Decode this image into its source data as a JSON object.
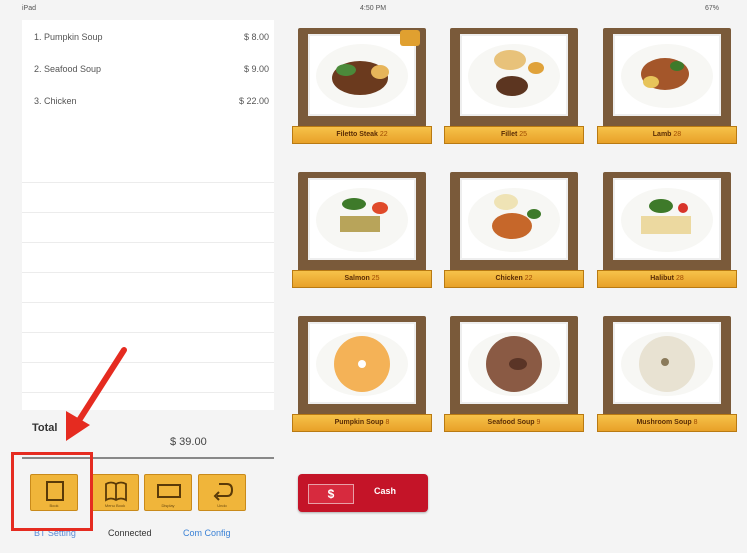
{
  "status_bar": {
    "left": "iPad",
    "center": "4:50 PM",
    "right": "67%"
  },
  "order_items": [
    {
      "name": "1. Pumpkin Soup",
      "price": "$ 8.00"
    },
    {
      "name": "2. Seafood Soup",
      "price": "$ 9.00"
    },
    {
      "name": "3. Chicken",
      "price": "$ 22.00"
    }
  ],
  "total": {
    "label": "Total",
    "value": "$ 39.00"
  },
  "toolbar": {
    "buttons": [
      {
        "label": "Book"
      },
      {
        "label": "Menu Book"
      },
      {
        "label": "Display"
      },
      {
        "label": "Undo"
      }
    ]
  },
  "footer": {
    "left": "BT Setting",
    "status": "Connected",
    "config": "Com Config"
  },
  "menu": [
    {
      "name": "Filetto Steak",
      "price": "22"
    },
    {
      "name": "Fillet",
      "price": "25"
    },
    {
      "name": "Lamb",
      "price": "28"
    },
    {
      "name": "Salmon",
      "price": "25"
    },
    {
      "name": "Chicken",
      "price": "22"
    },
    {
      "name": "Halibut",
      "price": "28"
    },
    {
      "name": "Pumpkin Soup",
      "price": "8"
    },
    {
      "name": "Seafood Soup",
      "price": "9"
    },
    {
      "name": "Mushroom Soup",
      "price": "8"
    }
  ],
  "cash_button": {
    "symbol": "$",
    "label": "Cash"
  },
  "colors": {
    "frame": "#7a5a3a",
    "label_gold": "#f0b53a",
    "cash_red": "#c41428",
    "annotation_red": "#e52b20"
  }
}
